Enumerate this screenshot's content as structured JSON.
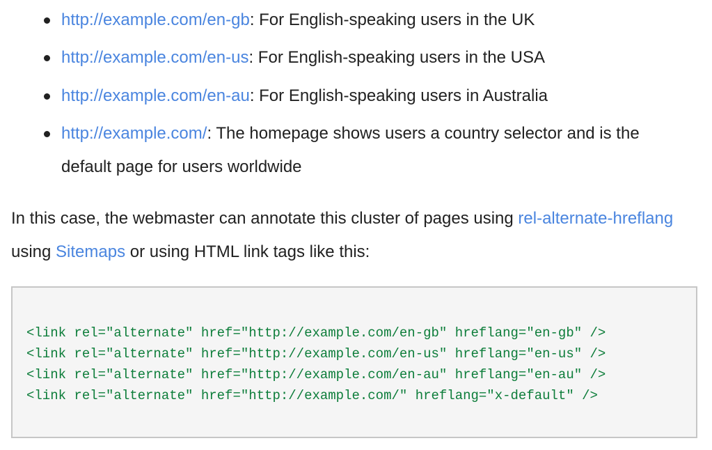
{
  "list": {
    "items": [
      {
        "link": "http://example.com/en-gb",
        "text": ": For English-speaking users in the UK"
      },
      {
        "link": "http://example.com/en-us",
        "text": ": For English-speaking users in the USA"
      },
      {
        "link": "http://example.com/en-au",
        "text": ": For English-speaking users in Australia"
      },
      {
        "link": "http://example.com/",
        "text": ": The homepage shows users a country selector and is the default page for users worldwide"
      }
    ]
  },
  "paragraph": {
    "part1": "In this case, the webmaster can annotate this cluster of pages using ",
    "link1": "rel-alternate-hreflang",
    "part2": " using ",
    "link2": "Sitemaps",
    "part3": " or using HTML link tags like this:"
  },
  "code": {
    "lines": [
      "<link rel=\"alternate\" href=\"http://example.com/en-gb\" hreflang=\"en-gb\" />",
      "<link rel=\"alternate\" href=\"http://example.com/en-us\" hreflang=\"en-us\" />",
      "<link rel=\"alternate\" href=\"http://example.com/en-au\" hreflang=\"en-au\" />",
      "<link rel=\"alternate\" href=\"http://example.com/\" hreflang=\"x-default\" />"
    ]
  },
  "colors": {
    "link": "#4a85df",
    "text": "#212121",
    "code_text": "#0d7d3a",
    "code_background": "#f5f5f5",
    "code_border": "#c6c6c6"
  }
}
